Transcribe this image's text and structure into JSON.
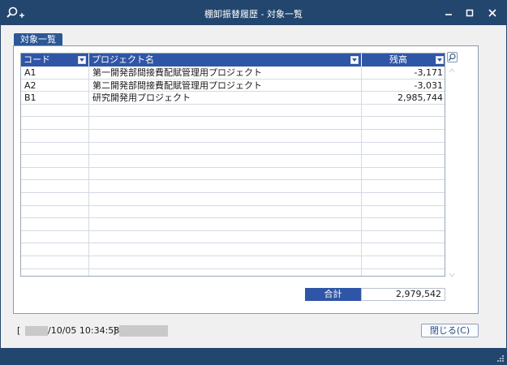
{
  "window": {
    "title": "棚卸振替履歴 - 対象一覧",
    "colors": {
      "titlebar": "#23466e",
      "header": "#2f56a6",
      "tab": "#2b5796"
    }
  },
  "tab": {
    "label": "対象一覧"
  },
  "grid": {
    "columns": [
      "コード",
      "プロジェクト名",
      "残高"
    ],
    "rows": [
      {
        "code": "A1",
        "name": "第一開発部間接費配賦管理用プロジェクト",
        "balance": "-3,171"
      },
      {
        "code": "A2",
        "name": "第二開発部間接費配賦管理用プロジェクト",
        "balance": "-3,031"
      },
      {
        "code": "B1",
        "name": "研究開発用プロジェクト",
        "balance": "2,985,744"
      }
    ],
    "empty_row_count": 14
  },
  "total": {
    "label": "合計",
    "value": "2,979,542"
  },
  "status": {
    "open_bracket": "[",
    "datetime": "/10/05 10:34:58",
    "close_bracket": "]"
  },
  "buttons": {
    "close": "閉じる(C)"
  },
  "icons": {
    "app": "search-add-icon",
    "minimize": "minimize-icon",
    "maximize": "maximize-icon",
    "close": "close-icon",
    "dropdown": "chevron-down-icon",
    "zoom": "search-icon",
    "grip": "resize-grip-icon"
  }
}
